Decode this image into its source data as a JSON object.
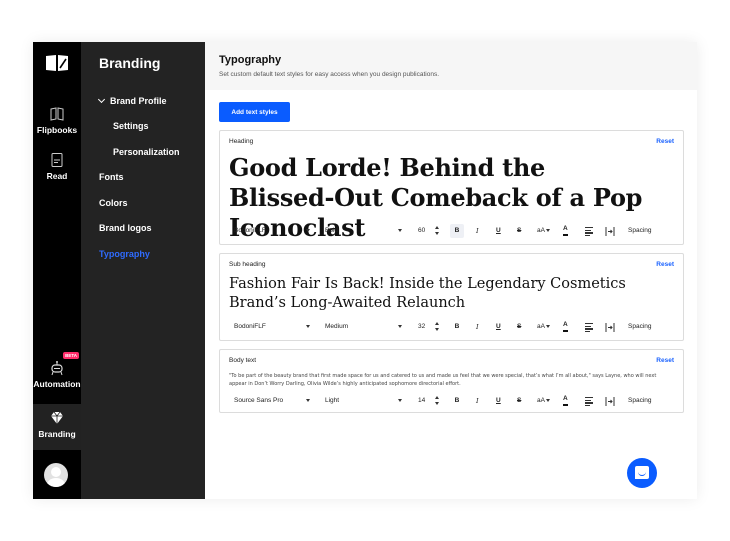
{
  "rail": {
    "items": [
      {
        "label": "Flipbooks",
        "icon": "book-icon"
      },
      {
        "label": "Read",
        "icon": "document-icon"
      },
      {
        "label": "Automation",
        "icon": "robot-icon",
        "badge": "BETA"
      },
      {
        "label": "Branding",
        "icon": "diamond-icon",
        "active": true
      }
    ]
  },
  "subnav": {
    "title": "Branding",
    "items": [
      {
        "label": "Brand Profile",
        "expanded": true
      },
      {
        "label": "Settings"
      },
      {
        "label": "Personalization"
      },
      {
        "label": "Fonts"
      },
      {
        "label": "Colors"
      },
      {
        "label": "Brand logos"
      },
      {
        "label": "Typography",
        "active": true
      }
    ]
  },
  "header": {
    "title": "Typography",
    "subtitle": "Set custom default text styles for easy access when you design publications."
  },
  "add_button": "Add text styles",
  "styles": [
    {
      "label": "Heading",
      "reset": "Reset",
      "sample": "Good Lorde! Behind the Blissed-Out Comeback of a Pop Iconoclast",
      "font": "BodoniFLF",
      "weight": "Bold",
      "size": "60",
      "case": "aA",
      "spacing": "Spacing"
    },
    {
      "label": "Sub heading",
      "reset": "Reset",
      "sample": "Fashion Fair Is Back! Inside the Legendary Cosmetics Brand’s Long-Awaited Relaunch",
      "font": "BodoniFLF",
      "weight": "Medium",
      "size": "32",
      "case": "aA",
      "spacing": "Spacing"
    },
    {
      "label": "Body text",
      "reset": "Reset",
      "sample": "\"To be part of the beauty brand that first made space for us and catered to us and made us feel that we were special, that’s what I’m all about,\" says Layne, who will next appear in Don’t Worry Darling, Olivia Wilde’s highly anticipated sophomore directorial effort.",
      "font": "Source Sans Pro",
      "weight": "Light",
      "size": "14",
      "case": "aA",
      "spacing": "Spacing"
    }
  ],
  "toolbar_labels": {
    "bold": "B",
    "italic": "I",
    "underline": "U",
    "strike": "S",
    "color": "A"
  },
  "colors": {
    "accent": "#0a5cff",
    "rail": "#000000",
    "subnav": "#232323",
    "beta": "#ff2d6b"
  }
}
